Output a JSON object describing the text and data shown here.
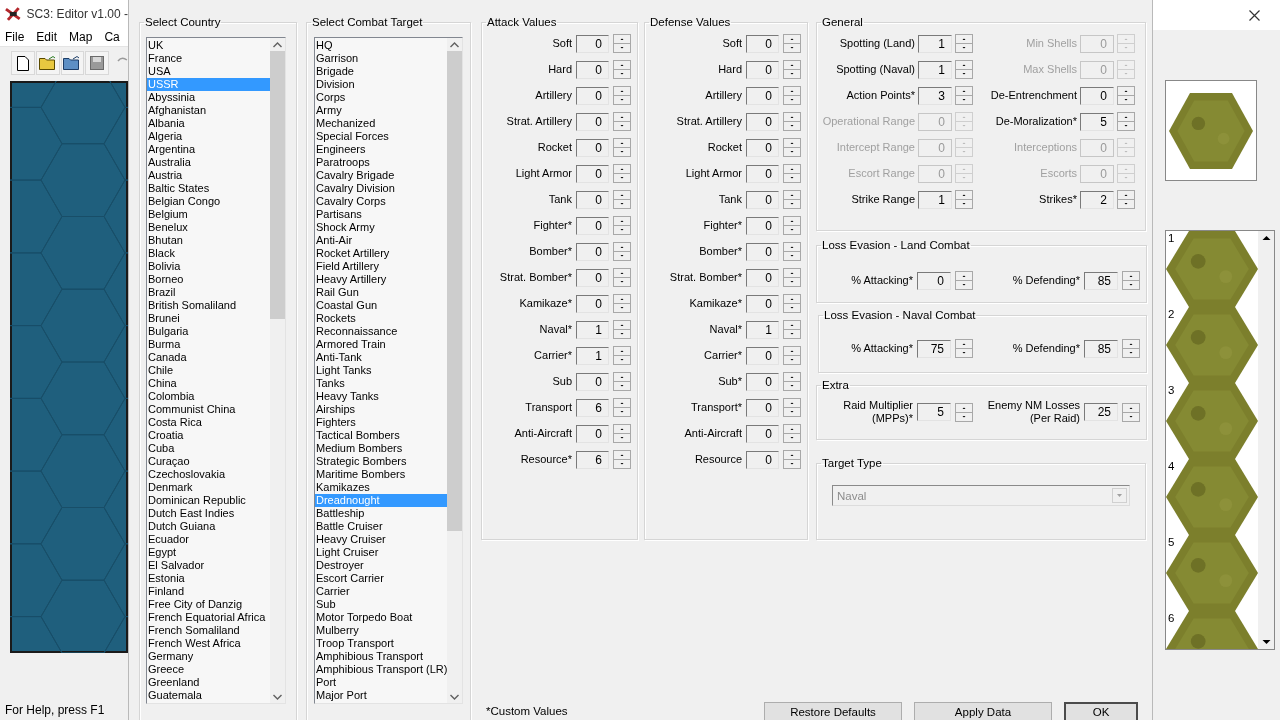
{
  "app_window": {
    "title": "SC3:  Editor v1.00 -",
    "menu": [
      "File",
      "Edit",
      "Map",
      "Ca"
    ],
    "status_bar": "For Help, press F1"
  },
  "dialog": {
    "country_list": {
      "title": "Select Country",
      "items": [
        {
          "label": "UK",
          "selected": false
        },
        {
          "label": "France",
          "selected": false
        },
        {
          "label": "USA",
          "selected": false
        },
        {
          "label": "USSR",
          "selected": true
        },
        {
          "label": "Abyssinia",
          "selected": false
        },
        {
          "label": "Afghanistan",
          "selected": false
        },
        {
          "label": "Albania",
          "selected": false
        },
        {
          "label": "Algeria",
          "selected": false
        },
        {
          "label": "Argentina",
          "selected": false
        },
        {
          "label": "Australia",
          "selected": false
        },
        {
          "label": "Austria",
          "selected": false
        },
        {
          "label": "Baltic States",
          "selected": false
        },
        {
          "label": "Belgian Congo",
          "selected": false
        },
        {
          "label": "Belgium",
          "selected": false
        },
        {
          "label": "Benelux",
          "selected": false
        },
        {
          "label": "Bhutan",
          "selected": false
        },
        {
          "label": "Black",
          "selected": false
        },
        {
          "label": "Bolivia",
          "selected": false
        },
        {
          "label": "Borneo",
          "selected": false
        },
        {
          "label": "Brazil",
          "selected": false
        },
        {
          "label": "British Somaliland",
          "selected": false
        },
        {
          "label": "Brunei",
          "selected": false
        },
        {
          "label": "Bulgaria",
          "selected": false
        },
        {
          "label": "Burma",
          "selected": false
        },
        {
          "label": "Canada",
          "selected": false
        },
        {
          "label": "Chile",
          "selected": false
        },
        {
          "label": "China",
          "selected": false
        },
        {
          "label": "Colombia",
          "selected": false
        },
        {
          "label": "Communist China",
          "selected": false
        },
        {
          "label": "Costa Rica",
          "selected": false
        },
        {
          "label": "Croatia",
          "selected": false
        },
        {
          "label": "Cuba",
          "selected": false
        },
        {
          "label": "Curaçao",
          "selected": false
        },
        {
          "label": "Czechoslovakia",
          "selected": false
        },
        {
          "label": "Denmark",
          "selected": false
        },
        {
          "label": "Dominican Republic",
          "selected": false
        },
        {
          "label": "Dutch East Indies",
          "selected": false
        },
        {
          "label": "Dutch Guiana",
          "selected": false
        },
        {
          "label": "Ecuador",
          "selected": false
        },
        {
          "label": "Egypt",
          "selected": false
        },
        {
          "label": "El Salvador",
          "selected": false
        },
        {
          "label": "Estonia",
          "selected": false
        },
        {
          "label": "Finland",
          "selected": false
        },
        {
          "label": "Free City of Danzig",
          "selected": false
        },
        {
          "label": "French Equatorial Africa",
          "selected": false
        },
        {
          "label": "French Somaliland",
          "selected": false
        },
        {
          "label": "French West Africa",
          "selected": false
        },
        {
          "label": "Germany",
          "selected": false
        },
        {
          "label": "Greece",
          "selected": false
        },
        {
          "label": "Greenland",
          "selected": false
        },
        {
          "label": "Guatemala",
          "selected": false
        }
      ]
    },
    "target_list": {
      "title": "Select Combat Target",
      "items": [
        {
          "label": "HQ",
          "selected": false
        },
        {
          "label": "Garrison",
          "selected": false
        },
        {
          "label": "Brigade",
          "selected": false
        },
        {
          "label": "Division",
          "selected": false
        },
        {
          "label": "Corps",
          "selected": false
        },
        {
          "label": "Army",
          "selected": false
        },
        {
          "label": "Mechanized",
          "selected": false
        },
        {
          "label": "Special Forces",
          "selected": false
        },
        {
          "label": "Engineers",
          "selected": false
        },
        {
          "label": "Paratroops",
          "selected": false
        },
        {
          "label": "Cavalry Brigade",
          "selected": false
        },
        {
          "label": "Cavalry Division",
          "selected": false
        },
        {
          "label": "Cavalry Corps",
          "selected": false
        },
        {
          "label": "Partisans",
          "selected": false
        },
        {
          "label": "Shock Army",
          "selected": false
        },
        {
          "label": "Anti-Air",
          "selected": false
        },
        {
          "label": "Rocket Artillery",
          "selected": false
        },
        {
          "label": "Field Artillery",
          "selected": false
        },
        {
          "label": "Heavy Artillery",
          "selected": false
        },
        {
          "label": "Rail Gun",
          "selected": false
        },
        {
          "label": "Coastal Gun",
          "selected": false
        },
        {
          "label": "Rockets",
          "selected": false
        },
        {
          "label": "Reconnaissance",
          "selected": false
        },
        {
          "label": "Armored Train",
          "selected": false
        },
        {
          "label": "Anti-Tank",
          "selected": false
        },
        {
          "label": "Light Tanks",
          "selected": false
        },
        {
          "label": "Tanks",
          "selected": false
        },
        {
          "label": "Heavy Tanks",
          "selected": false
        },
        {
          "label": "Airships",
          "selected": false
        },
        {
          "label": "Fighters",
          "selected": false
        },
        {
          "label": "Tactical Bombers",
          "selected": false
        },
        {
          "label": "Medium Bombers",
          "selected": false
        },
        {
          "label": "Strategic Bombers",
          "selected": false
        },
        {
          "label": "Maritime Bombers",
          "selected": false
        },
        {
          "label": "Kamikazes",
          "selected": false
        },
        {
          "label": "Dreadnought",
          "selected": true
        },
        {
          "label": "Battleship",
          "selected": false
        },
        {
          "label": "Battle Cruiser",
          "selected": false
        },
        {
          "label": "Heavy Cruiser",
          "selected": false
        },
        {
          "label": "Light Cruiser",
          "selected": false
        },
        {
          "label": "Destroyer",
          "selected": false
        },
        {
          "label": "Escort Carrier",
          "selected": false
        },
        {
          "label": "Carrier",
          "selected": false
        },
        {
          "label": "Sub",
          "selected": false
        },
        {
          "label": "Motor Torpedo Boat",
          "selected": false
        },
        {
          "label": "Mulberry",
          "selected": false
        },
        {
          "label": "Troop Transport",
          "selected": false
        },
        {
          "label": "Amphibious Transport",
          "selected": false
        },
        {
          "label": "Amphibious Transport (LR)",
          "selected": false
        },
        {
          "label": "Port",
          "selected": false
        },
        {
          "label": "Major Port",
          "selected": false
        }
      ]
    },
    "attack": {
      "title": "Attack Values",
      "fields": [
        {
          "label": "Soft",
          "value": "0"
        },
        {
          "label": "Hard",
          "value": "0"
        },
        {
          "label": "Artillery",
          "value": "0"
        },
        {
          "label": "Strat. Artillery",
          "value": "0"
        },
        {
          "label": "Rocket",
          "value": "0"
        },
        {
          "label": "Light Armor",
          "value": "0"
        },
        {
          "label": "Tank",
          "value": "0"
        },
        {
          "label": "Fighter*",
          "value": "0"
        },
        {
          "label": "Bomber*",
          "value": "0"
        },
        {
          "label": "Strat. Bomber*",
          "value": "0"
        },
        {
          "label": "Kamikaze*",
          "value": "0"
        },
        {
          "label": "Naval*",
          "value": "1"
        },
        {
          "label": "Carrier*",
          "value": "1"
        },
        {
          "label": "Sub",
          "value": "0"
        },
        {
          "label": "Transport",
          "value": "6"
        },
        {
          "label": "Anti-Aircraft",
          "value": "0"
        },
        {
          "label": "Resource*",
          "value": "6"
        }
      ]
    },
    "defense": {
      "title": "Defense Values",
      "fields": [
        {
          "label": "Soft",
          "value": "0"
        },
        {
          "label": "Hard",
          "value": "0"
        },
        {
          "label": "Artillery",
          "value": "0"
        },
        {
          "label": "Strat. Artillery",
          "value": "0"
        },
        {
          "label": "Rocket",
          "value": "0"
        },
        {
          "label": "Light Armor",
          "value": "0"
        },
        {
          "label": "Tank",
          "value": "0"
        },
        {
          "label": "Fighter*",
          "value": "0"
        },
        {
          "label": "Bomber*",
          "value": "0"
        },
        {
          "label": "Strat. Bomber*",
          "value": "0"
        },
        {
          "label": "Kamikaze*",
          "value": "0"
        },
        {
          "label": "Naval*",
          "value": "1"
        },
        {
          "label": "Carrier*",
          "value": "0"
        },
        {
          "label": "Sub*",
          "value": "0"
        },
        {
          "label": "Transport*",
          "value": "0"
        },
        {
          "label": "Anti-Aircraft",
          "value": "0"
        },
        {
          "label": "Resource",
          "value": "0"
        }
      ]
    },
    "general": {
      "title": "General",
      "fields": [
        {
          "label": "Spotting (Land)",
          "value": "1",
          "disabled": false
        },
        {
          "label": "Min Shells",
          "value": "0",
          "disabled": true
        },
        {
          "label": "Spotting (Naval)",
          "value": "1",
          "disabled": false
        },
        {
          "label": "Max Shells",
          "value": "0",
          "disabled": true
        },
        {
          "label": "Action Points*",
          "value": "3",
          "disabled": false
        },
        {
          "label": "De-Entrenchment",
          "value": "0",
          "disabled": false
        },
        {
          "label": "Operational Range",
          "value": "0",
          "disabled": true
        },
        {
          "label": "De-Moralization*",
          "value": "5",
          "disabled": false
        },
        {
          "label": "Intercept Range",
          "value": "0",
          "disabled": true
        },
        {
          "label": "Interceptions",
          "value": "0",
          "disabled": true
        },
        {
          "label": "Escort Range",
          "value": "0",
          "disabled": true
        },
        {
          "label": "Escorts",
          "value": "0",
          "disabled": true
        },
        {
          "label": "Strike Range",
          "value": "1",
          "disabled": false
        },
        {
          "label": "Strikes*",
          "value": "2",
          "disabled": false
        }
      ]
    },
    "loss_land": {
      "title": "Loss Evasion - Land Combat",
      "fields": [
        {
          "label": "% Attacking*",
          "value": "0"
        },
        {
          "label": "% Defending*",
          "value": "85"
        }
      ]
    },
    "loss_naval": {
      "title": "Loss Evasion - Naval Combat",
      "fields": [
        {
          "label": "% Attacking*",
          "value": "75"
        },
        {
          "label": "% Defending*",
          "value": "85"
        }
      ]
    },
    "extra": {
      "title": "Extra",
      "fields": [
        {
          "label": "Raid Multiplier (MPPs)*",
          "value": "5"
        },
        {
          "label": "Enemy NM Losses (Per Raid)",
          "value": "25"
        }
      ]
    },
    "target_type": {
      "title": "Target Type",
      "value": "Naval",
      "disabled": true
    },
    "footnote": "*Custom Values",
    "buttons": [
      {
        "label": "Restore Defaults",
        "default": false
      },
      {
        "label": "Apply Data",
        "default": false
      },
      {
        "label": "OK",
        "default": true
      }
    ]
  },
  "tile_panel": {
    "tiles": [
      "1",
      "2",
      "3",
      "4",
      "5",
      "6"
    ]
  }
}
